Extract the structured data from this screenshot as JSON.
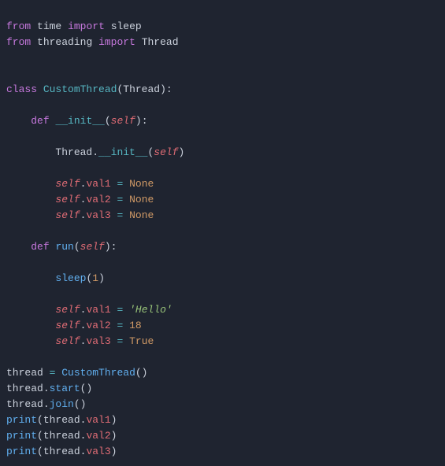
{
  "line1": {
    "from": "from",
    "mod_time": "time",
    "import": "import",
    "name_sleep": "sleep"
  },
  "line2": {
    "from": "from",
    "mod_threading": "threading",
    "import": "import",
    "name_Thread": "Thread"
  },
  "line5": {
    "class": "class",
    "name": "CustomThread",
    "base": "Thread"
  },
  "line7": {
    "def": "def",
    "name": "__init__",
    "self": "self"
  },
  "line9": {
    "thread": "Thread",
    "dund": "__init__",
    "self": "self"
  },
  "line11": {
    "self": "self",
    "attr": "val1",
    "eq": "=",
    "val": "None"
  },
  "line12": {
    "self": "self",
    "attr": "val2",
    "eq": "=",
    "val": "None"
  },
  "line13": {
    "self": "self",
    "attr": "val3",
    "eq": "=",
    "val": "None"
  },
  "line15": {
    "def": "def",
    "name": "run",
    "self": "self"
  },
  "line17": {
    "fn": "sleep",
    "arg": "1"
  },
  "line19": {
    "self": "self",
    "attr": "val1",
    "eq": "=",
    "val": "'Hello'"
  },
  "line20": {
    "self": "self",
    "attr": "val2",
    "eq": "=",
    "val": "18"
  },
  "line21": {
    "self": "self",
    "attr": "val3",
    "eq": "=",
    "val": "True"
  },
  "line23": {
    "lhs": "thread",
    "eq": "=",
    "rhs": "CustomThread"
  },
  "line24": {
    "obj": "thread",
    "method": "start"
  },
  "line25": {
    "obj": "thread",
    "method": "join"
  },
  "line26": {
    "fn": "print",
    "obj": "thread",
    "attr": "val1"
  },
  "line27": {
    "fn": "print",
    "obj": "thread",
    "attr": "val2"
  },
  "line28": {
    "fn": "print",
    "obj": "thread",
    "attr": "val3"
  }
}
